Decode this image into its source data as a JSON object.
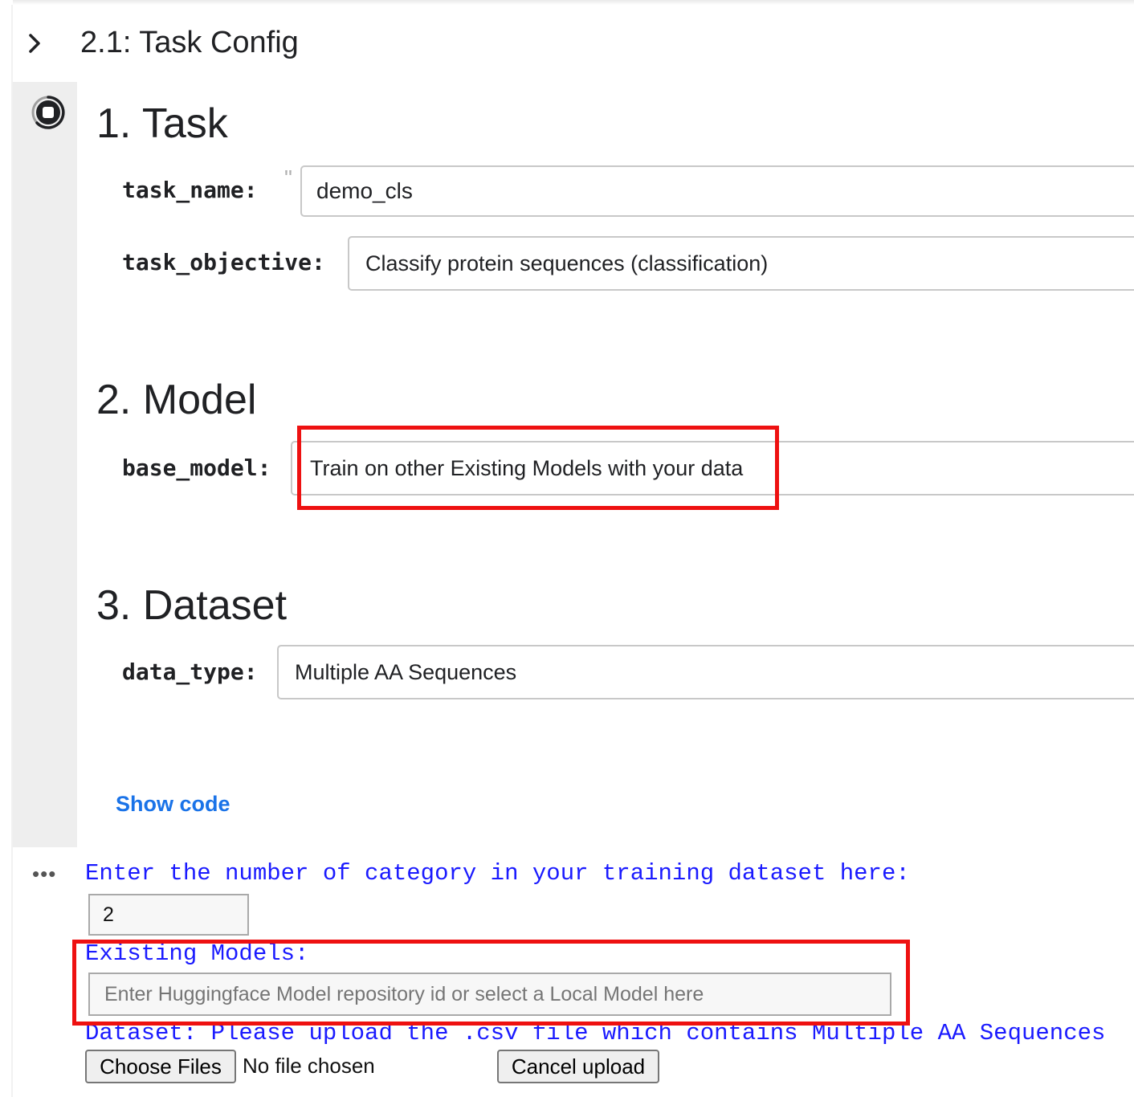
{
  "cell": {
    "title": "2.1: Task Config",
    "show_code_label": "Show code"
  },
  "sections": {
    "task": {
      "heading": "1. Task",
      "task_name_label": "task_name:",
      "task_name_quote": "\"",
      "task_name_value": "demo_cls",
      "task_objective_label": "task_objective:",
      "task_objective_value": "Classify protein sequences (classification)"
    },
    "model": {
      "heading": "2. Model",
      "base_model_label": "base_model:",
      "base_model_value": "Train on other Existing Models with your data"
    },
    "dataset": {
      "heading": "3. Dataset",
      "data_type_label": "data_type:",
      "data_type_value": "Multiple AA Sequences"
    }
  },
  "output": {
    "more_icon": "•••",
    "category_prompt": "Enter the number of category in your training dataset here:",
    "category_value": "2",
    "existing_models_label": "Existing Models:",
    "existing_models_placeholder": "Enter Huggingface Model repository id or select a Local Model here",
    "dataset_prompt": "Dataset: Please upload the .csv file which contains Multiple AA Sequences",
    "choose_files_label": "Choose Files",
    "no_file_text": "No file chosen",
    "cancel_upload_label": "Cancel upload"
  },
  "colors": {
    "highlight": "#ee1111",
    "output_text": "#1a1aff",
    "link": "#1a73e8"
  },
  "icons": [
    "chevron-right-icon",
    "stop-run-icon",
    "more-options-icon"
  ]
}
